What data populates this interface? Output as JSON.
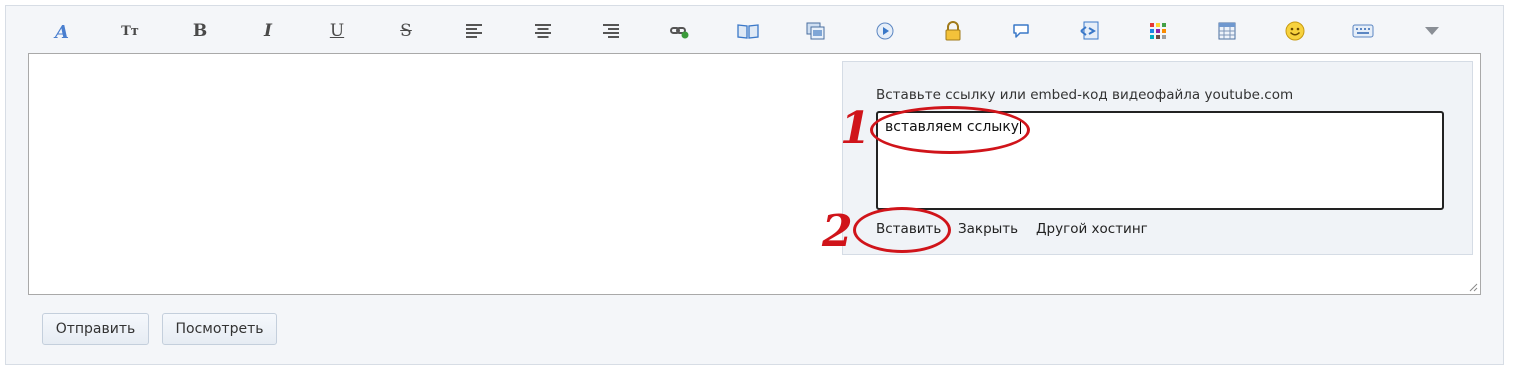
{
  "toolbar": {
    "items": [
      {
        "icon": "font-style-icon"
      },
      {
        "icon": "font-size-icon",
        "glyph": "Tт"
      },
      {
        "icon": "bold-icon",
        "glyph": "B"
      },
      {
        "icon": "italic-icon",
        "glyph": "I"
      },
      {
        "icon": "underline-icon",
        "glyph": "U"
      },
      {
        "icon": "strikethrough-icon",
        "glyph": "S"
      },
      {
        "icon": "align-left-icon"
      },
      {
        "icon": "align-center-icon"
      },
      {
        "icon": "align-right-icon"
      },
      {
        "icon": "link-icon"
      },
      {
        "icon": "book-icon"
      },
      {
        "icon": "image-icon"
      },
      {
        "icon": "media-icon"
      },
      {
        "icon": "lock-icon"
      },
      {
        "icon": "speech-bubble-icon"
      },
      {
        "icon": "code-icon"
      },
      {
        "icon": "color-palette-icon"
      },
      {
        "icon": "table-icon"
      },
      {
        "icon": "smiley-icon"
      },
      {
        "icon": "keyboard-icon"
      },
      {
        "icon": "more-dropdown-icon"
      }
    ]
  },
  "embed_popup": {
    "label": "Вставьте ссылку или embed-код видеофайла youtube.com",
    "input_value": "вставляем сслыку",
    "insert_label": "Вставить",
    "close_label": "Закрыть",
    "other_hosting_label": "Другой хостинг"
  },
  "annotations": {
    "step1": "1",
    "step2": "2",
    "color": "#d0141a"
  },
  "footer": {
    "send_label": "Отправить",
    "preview_label": "Посмотреть"
  },
  "colors": {
    "accent_blue": "#3a78c8",
    "annotation_red": "#d0141a"
  }
}
